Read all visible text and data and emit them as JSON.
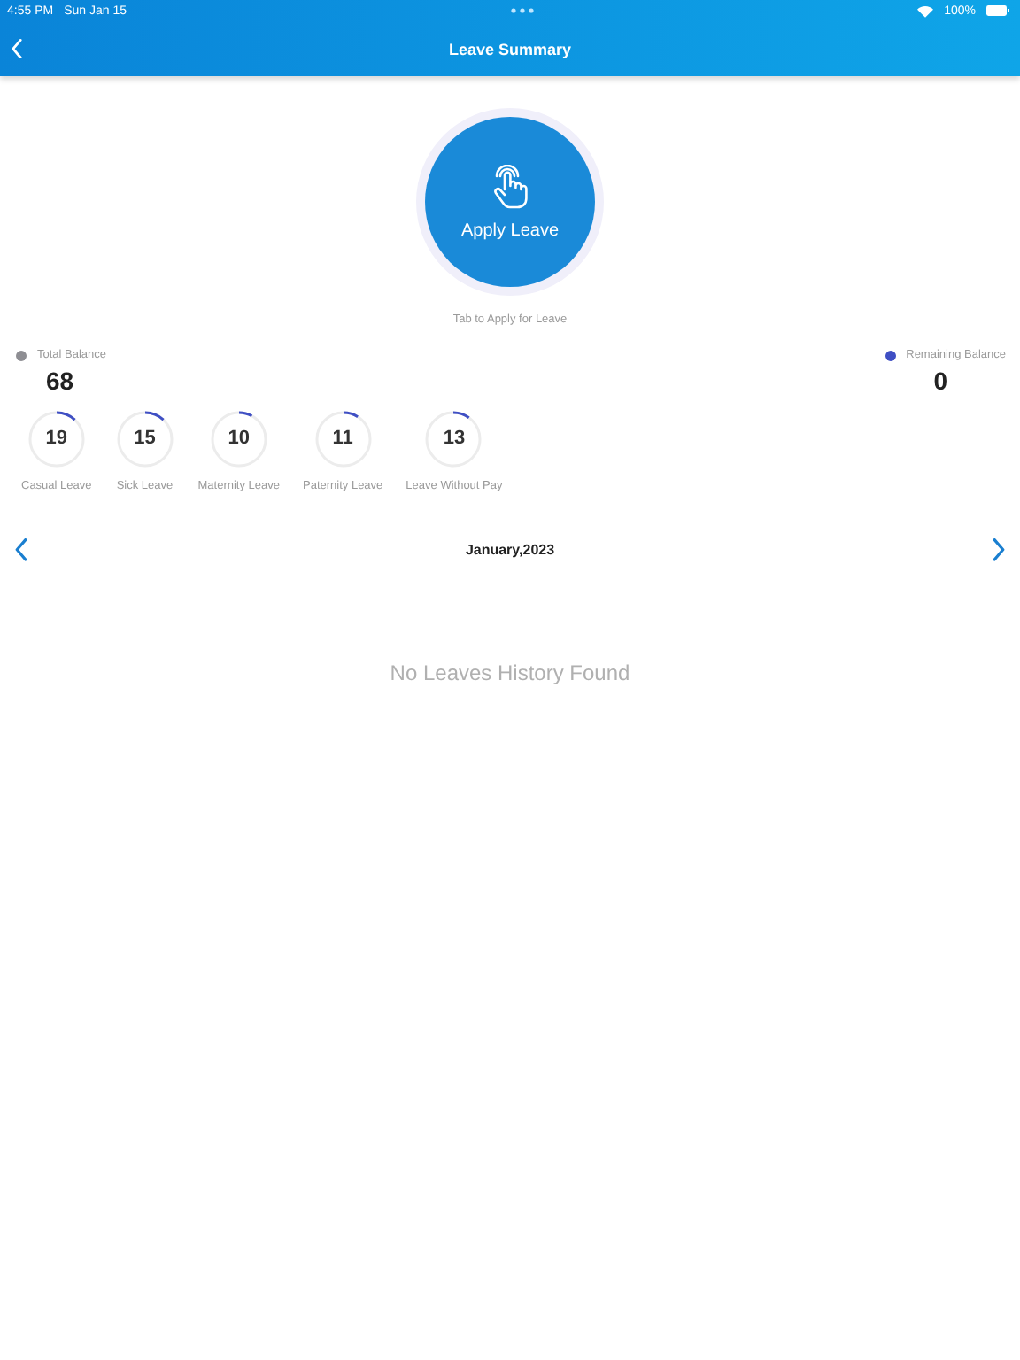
{
  "status_bar": {
    "time": "4:55 PM",
    "date": "Sun Jan 15",
    "battery": "100%"
  },
  "header": {
    "title": "Leave Summary"
  },
  "apply_button": {
    "label": "Apply Leave",
    "caption": "Tab to Apply for Leave"
  },
  "balances": [
    {
      "label": "Total Balance",
      "value": "68",
      "color": "#8e8e93"
    },
    {
      "label": "Remaining Balance",
      "value": "0",
      "color": "#3f4fc4"
    }
  ],
  "leave_types": [
    {
      "count": "19",
      "label": "Casual Leave",
      "level": 0.12
    },
    {
      "count": "15",
      "label": "Sick Leave",
      "level": 0.12
    },
    {
      "count": "10",
      "label": "Maternity Leave",
      "level": 0.08
    },
    {
      "count": "11",
      "label": "Paternity Leave",
      "level": 0.09
    },
    {
      "count": "13",
      "label": "Leave Without Pay",
      "level": 0.1
    }
  ],
  "month": "January,2023",
  "empty_message": "No Leaves History Found"
}
